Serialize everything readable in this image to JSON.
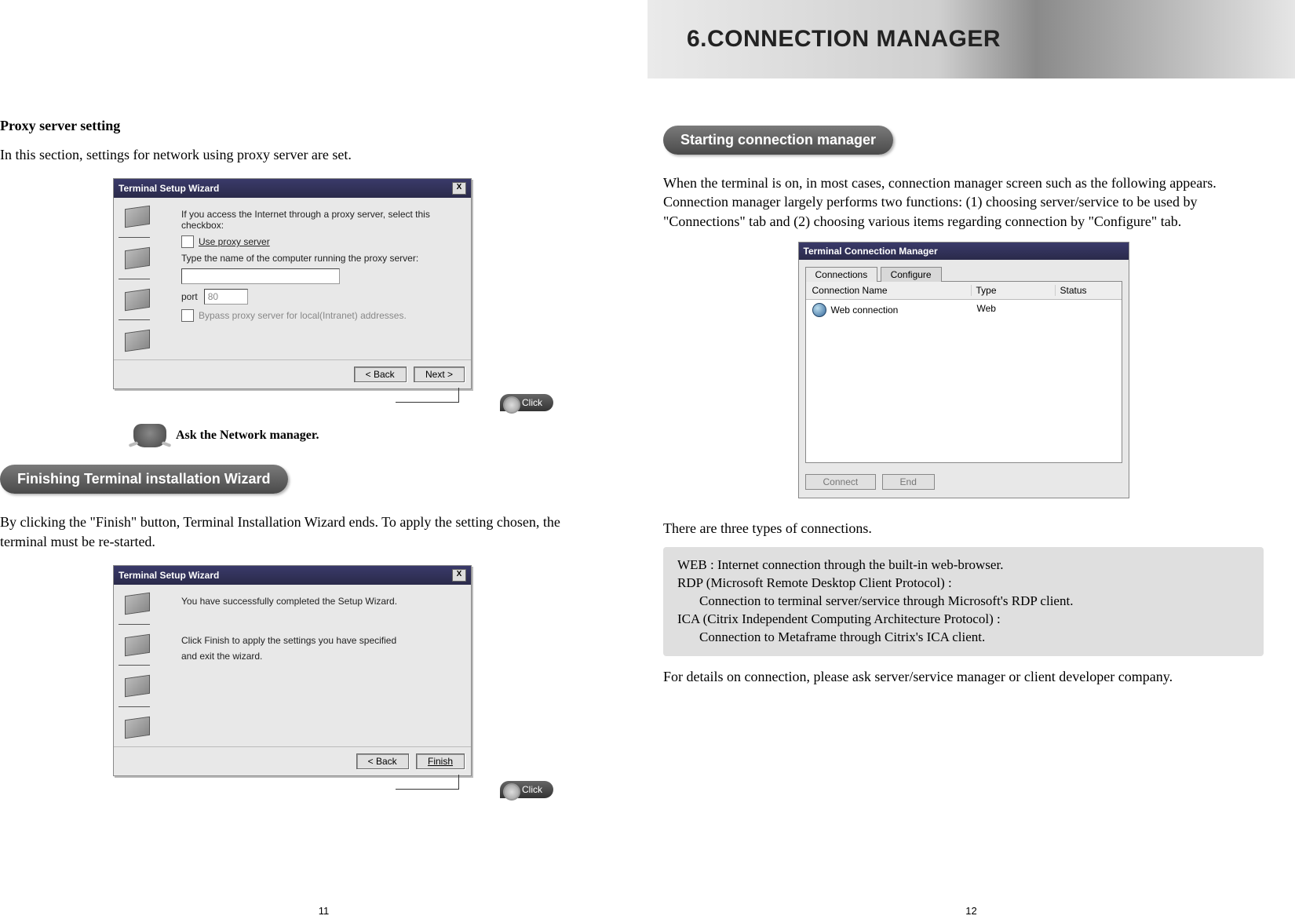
{
  "left": {
    "proxy_heading": "Proxy server setting",
    "proxy_intro": "In this section, settings for network using proxy server are set.",
    "wizard1": {
      "title": "Terminal Setup Wizard",
      "line1": "If you access the Internet through a proxy server, select this checkbox:",
      "checkbox_label": "Use proxy server",
      "line2": "Type the name of the computer running the proxy server:",
      "port_label": "port",
      "port_value": "80",
      "bypass_label": "Bypass proxy server for local(Intranet) addresses.",
      "back": "< Back",
      "next": "Next >"
    },
    "click_label": "Click",
    "ask_text": "Ask the Network manager.",
    "pill_finish": "Finishing Terminal installation Wizard",
    "finish_body": "By clicking the \"Finish\" button, Terminal Installation Wizard ends. To apply the setting chosen, the terminal must be re-started.",
    "wizard2": {
      "title": "Terminal Setup Wizard",
      "line1": "You have successfully completed the Setup Wizard.",
      "line2": "Click Finish to apply the settings you have specified",
      "line3": "and exit the wizard.",
      "back": "< Back",
      "finish": "Finish"
    },
    "page_num": "11"
  },
  "right": {
    "banner": "6.CONNECTION MANAGER",
    "pill_start": "Starting connection manager",
    "intro": "When the terminal is on, in most cases, connection manager screen such as the following appears. Connection manager largely performs two functions: (1) choosing server/service to be used by \"Connections\" tab and (2) choosing various items regarding connection by \"Configure\" tab.",
    "cm": {
      "title": "Terminal Connection Manager",
      "tab_connections": "Connections",
      "tab_configure": "Configure",
      "col_name": "Connection Name",
      "col_type": "Type",
      "col_status": "Status",
      "row_name": "Web connection",
      "row_type": "Web",
      "row_status": "",
      "btn_connect": "Connect",
      "btn_end": "End"
    },
    "types_intro": "There are three types of connections.",
    "box": {
      "web": "WEB :  Internet connection through the built-in web-browser.",
      "rdp_h": "RDP (Microsoft Remote Desktop Client Protocol) :",
      "rdp_b": "Connection to terminal server/service through Microsoft's RDP client.",
      "ica_h": "ICA (Citrix Independent Computing Architecture Protocol) :",
      "ica_b": "Connection to Metaframe through Citrix's  ICA client."
    },
    "outro": "For details on connection, please ask server/service manager or client developer company.",
    "page_num": "12"
  }
}
